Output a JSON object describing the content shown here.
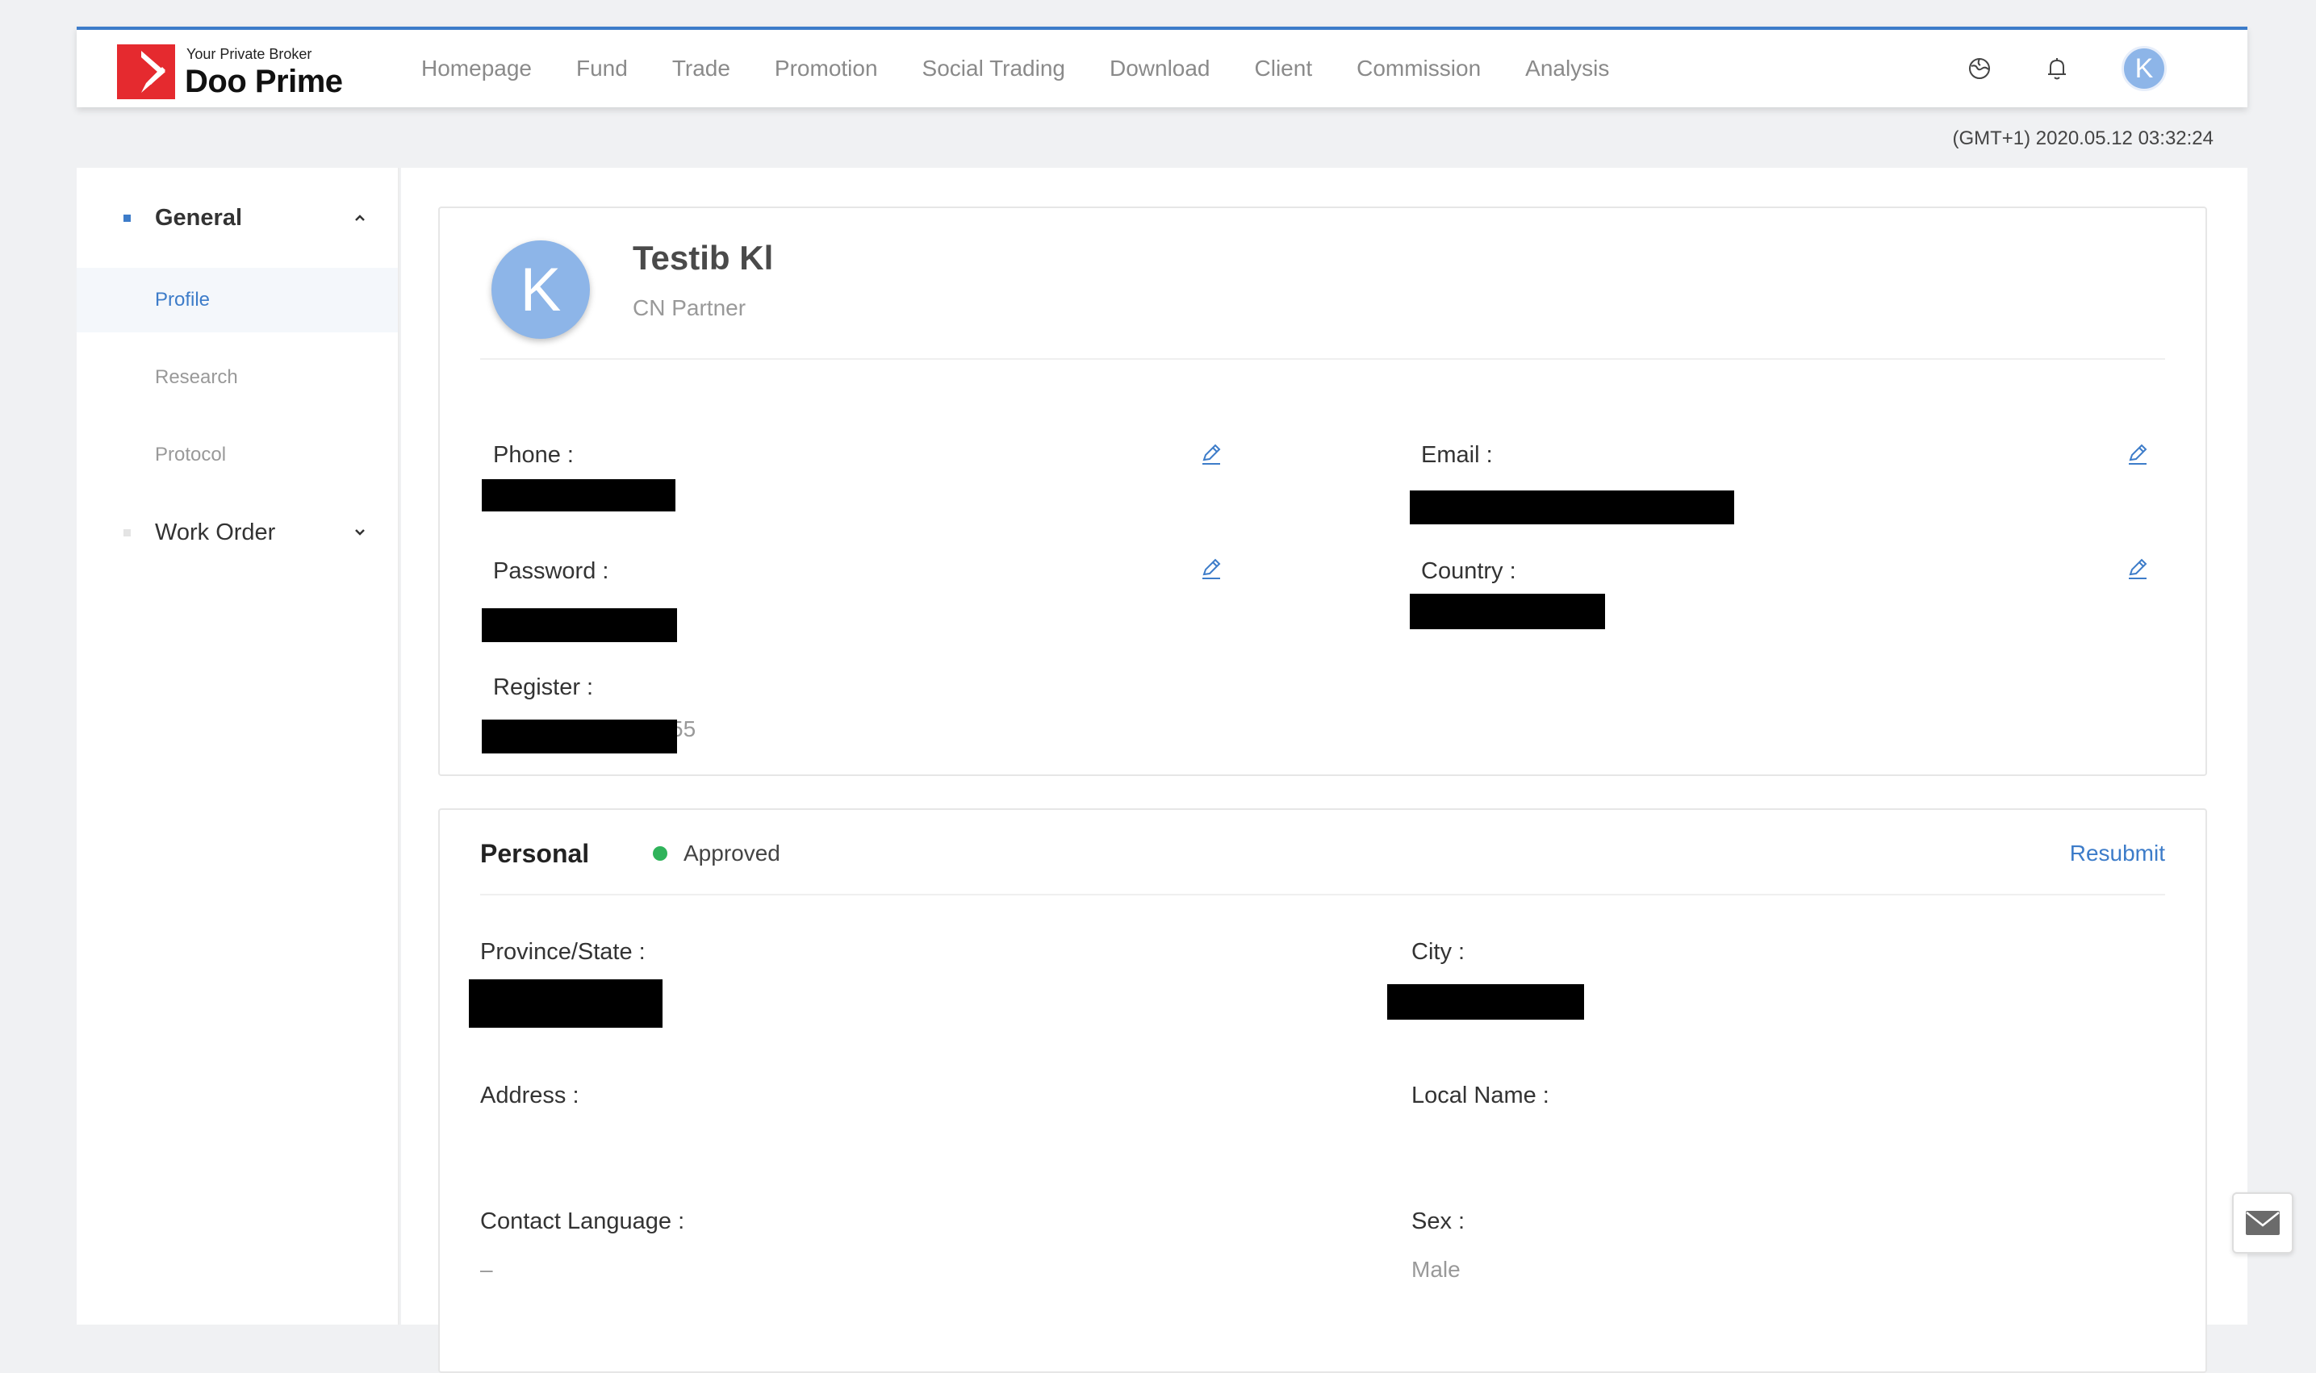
{
  "brand": {
    "tagline": "Your Private Broker",
    "name": "Doo Prime",
    "color": "#e52a2f"
  },
  "nav": {
    "items": [
      "Homepage",
      "Fund",
      "Trade",
      "Promotion",
      "Social Trading",
      "Download",
      "Client",
      "Commission",
      "Analysis"
    ]
  },
  "header": {
    "avatar_letter": "K",
    "icons": [
      "language-globe-icon",
      "notification-bell-icon"
    ]
  },
  "timestamp": "(GMT+1) 2020.05.12 03:32:24",
  "sidebar": {
    "general_label": "General",
    "items": [
      "Profile",
      "Research",
      "Protocol"
    ],
    "work_order_label": "Work Order"
  },
  "profile": {
    "avatar_letter": "K",
    "name": "Testib Kl",
    "role": "CN Partner",
    "phone_label": "Phone :",
    "email_label": "Email :",
    "password_label": "Password :",
    "country_label": "Country :",
    "register_label": "Register :",
    "register_tail": "55"
  },
  "personal": {
    "title": "Personal",
    "status": "Approved",
    "resubmit": "Resubmit",
    "province_label": "Province/State :",
    "city_label": "City :",
    "address_label": "Address :",
    "local_name_label": "Local Name :",
    "contact_language_label": "Contact Language :",
    "contact_language_value": "–",
    "sex_label": "Sex :",
    "sex_value": "Male"
  },
  "colors": {
    "accent": "#3d7cc9",
    "approved": "#2fb35a",
    "avatar": "#8db5e8"
  }
}
